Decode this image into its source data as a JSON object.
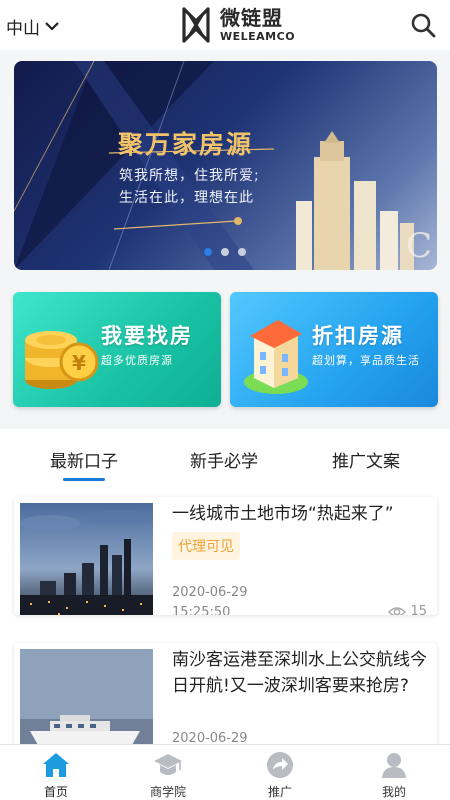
{
  "header": {
    "city": "中山",
    "logo_cn": "微链盟",
    "logo_en": "WELEAMCO"
  },
  "banner": {
    "title": "聚万家房源",
    "line1": "筑我所想，住我所爱;",
    "line2": "生活在此，理想在此",
    "active_index": 0,
    "dot_count": 3
  },
  "features": [
    {
      "title": "我要找房",
      "subtitle": "超多优质房源"
    },
    {
      "title": "折扣房源",
      "subtitle": "超划算，享品质生活"
    }
  ],
  "tabs": [
    "最新口子",
    "新手必学",
    "推广文案"
  ],
  "articles": [
    {
      "title": "一线城市土地市场“热起来了”",
      "tag": "代理可见",
      "date": "2020-06-29",
      "time": "15:25:50",
      "views": "15"
    },
    {
      "title": "南沙客运港至深圳水上公交航线今日开航!又一波深圳客要来抢房?",
      "date": "2020-06-29"
    }
  ],
  "bottom_nav": [
    {
      "label": "首页",
      "icon": "home-icon"
    },
    {
      "label": "商学院",
      "icon": "graduation-cap-icon"
    },
    {
      "label": "推广",
      "icon": "share-arrow-icon"
    },
    {
      "label": "我的",
      "icon": "user-icon"
    }
  ],
  "colors": {
    "accent": "#1d79d9",
    "tag_text": "#f0a23a",
    "card_green": "#19c2a4",
    "card_blue": "#24a3ef"
  }
}
